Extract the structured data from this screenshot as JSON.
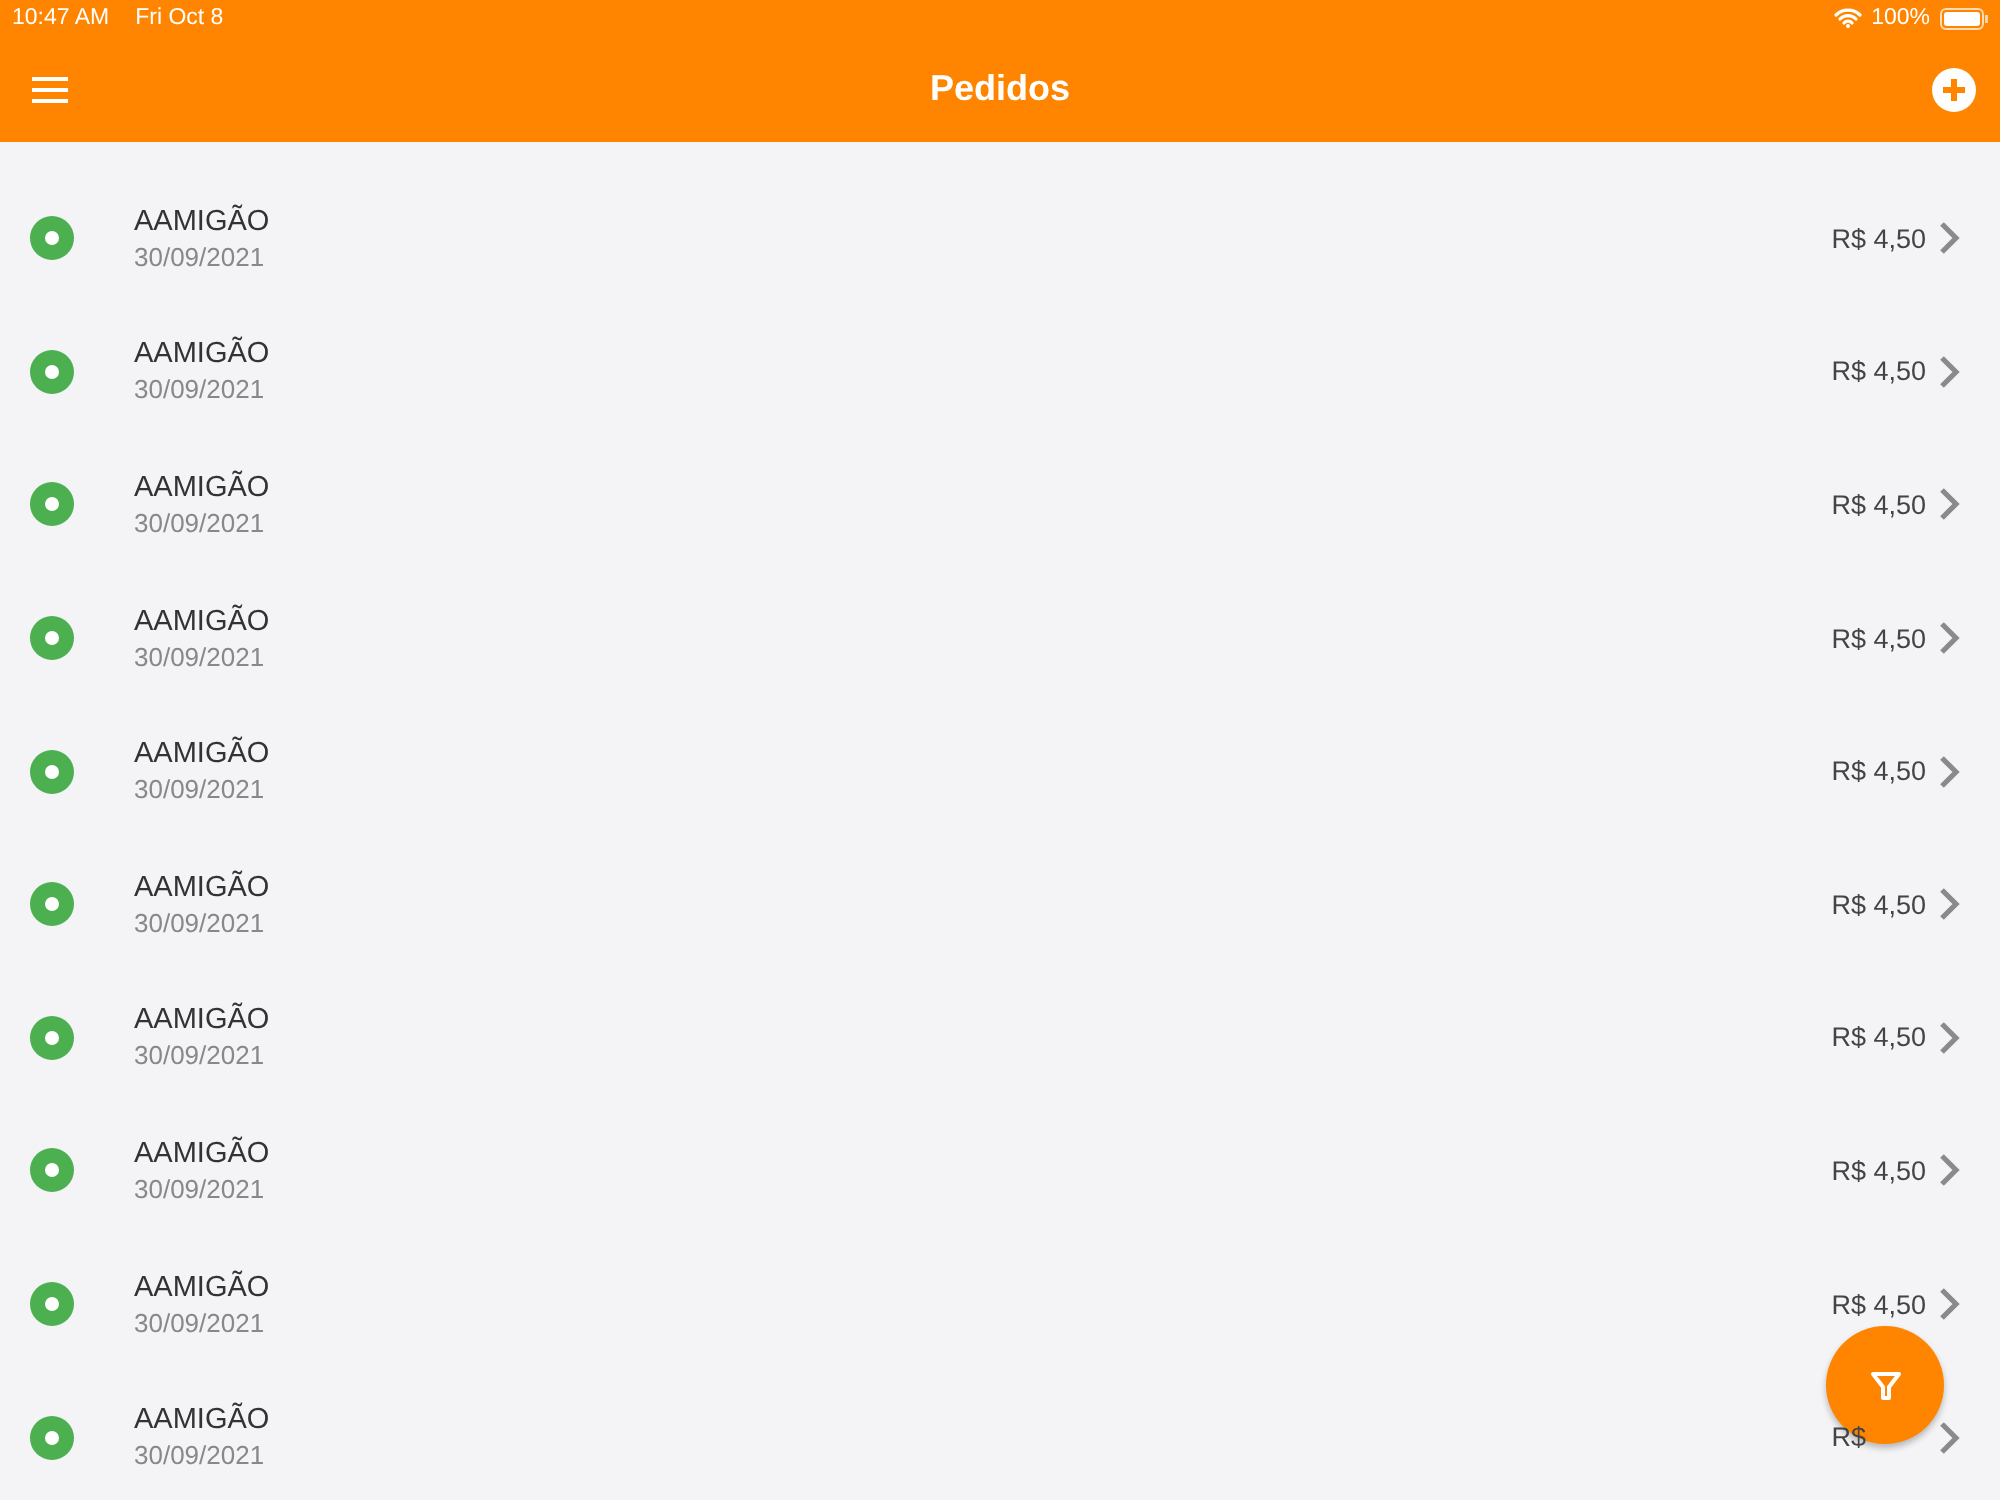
{
  "status_bar": {
    "time": "10:47 AM",
    "date": "Fri Oct 8",
    "battery": "100%"
  },
  "header": {
    "title": "Pedidos"
  },
  "orders": [
    {
      "name": "AAMIGÃO",
      "date": "30/09/2021",
      "price": "R$ 4,50",
      "color": "#4caf50"
    },
    {
      "name": "AAMIGÃO",
      "date": "30/09/2021",
      "price": "R$ 4,50",
      "color": "#4caf50"
    },
    {
      "name": "AAMIGÃO",
      "date": "30/09/2021",
      "price": "R$ 4,50",
      "color": "#4caf50"
    },
    {
      "name": "AAMIGÃO",
      "date": "30/09/2021",
      "price": "R$ 4,50",
      "color": "#4caf50"
    },
    {
      "name": "AAMIGÃO",
      "date": "30/09/2021",
      "price": "R$ 4,50",
      "color": "#4caf50"
    },
    {
      "name": "AAMIGÃO",
      "date": "30/09/2021",
      "price": "R$ 4,50",
      "color": "#4caf50"
    },
    {
      "name": "AAMIGÃO",
      "date": "30/09/2021",
      "price": "R$ 4,50",
      "color": "#4caf50"
    },
    {
      "name": "AAMIGÃO",
      "date": "30/09/2021",
      "price": "R$ 4,50",
      "color": "#4caf50"
    },
    {
      "name": "AAMIGÃO",
      "date": "30/09/2021",
      "price": "R$ 4,50",
      "color": "#4caf50"
    },
    {
      "name": "AAMIGÃO",
      "date": "30/09/2021",
      "price": "R$",
      "color": "#4caf50"
    }
  ]
}
